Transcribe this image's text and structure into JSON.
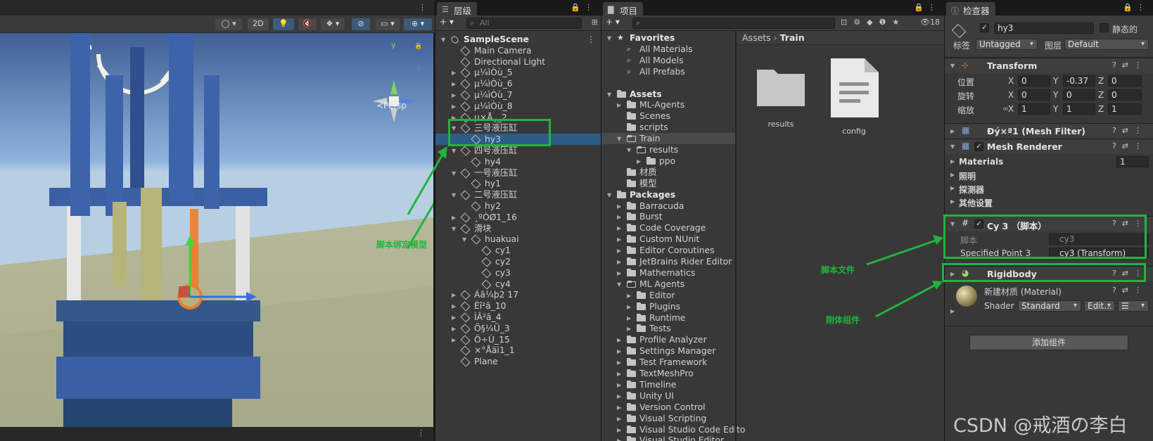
{
  "scene": {
    "toolbar": {
      "mode_2d": "2D"
    },
    "gizmo": {
      "persp_label": "≺Persp",
      "axis_y": "y",
      "axis_z": "z"
    },
    "annotation": "脚本绑定模型"
  },
  "hierarchy": {
    "tab": "层级",
    "search_placeholder": "All",
    "add": "+ ▾",
    "rows": [
      {
        "label": "SampleScene",
        "depth": 0,
        "arrow": "▼",
        "icon": "unity-icon",
        "bold": true
      },
      {
        "label": "Main Camera",
        "depth": 1,
        "arrow": "",
        "icon": "cube-icon"
      },
      {
        "label": "Directional Light",
        "depth": 1,
        "arrow": "",
        "icon": "cube-icon"
      },
      {
        "label": "µ¼ìÒù_5",
        "depth": 1,
        "arrow": "▶",
        "icon": "cube-icon"
      },
      {
        "label": "µ¼ìÒù_6",
        "depth": 1,
        "arrow": "▶",
        "icon": "cube-icon"
      },
      {
        "label": "µ¼ìÒù_7",
        "depth": 1,
        "arrow": "▶",
        "icon": "cube-icon"
      },
      {
        "label": "µ¼ìÒù_8",
        "depth": 1,
        "arrow": "▶",
        "icon": "cube-icon"
      },
      {
        "label": "µ×Å¸_2",
        "depth": 1,
        "arrow": "▶",
        "icon": "cube-icon"
      },
      {
        "label": "三号液压缸",
        "depth": 1,
        "arrow": "▼",
        "icon": "cube-icon"
      },
      {
        "label": "hy3",
        "depth": 2,
        "arrow": "",
        "icon": "cube-icon",
        "selected": true
      },
      {
        "label": "四号液压缸",
        "depth": 1,
        "arrow": "▼",
        "icon": "cube-icon"
      },
      {
        "label": "hy4",
        "depth": 2,
        "arrow": "",
        "icon": "cube-icon"
      },
      {
        "label": "一号液压缸",
        "depth": 1,
        "arrow": "▼",
        "icon": "cube-icon"
      },
      {
        "label": "hy1",
        "depth": 2,
        "arrow": "",
        "icon": "cube-icon"
      },
      {
        "label": "二号液压缸",
        "depth": 1,
        "arrow": "▼",
        "icon": "cube-icon"
      },
      {
        "label": "hy2",
        "depth": 2,
        "arrow": "",
        "icon": "cube-icon"
      },
      {
        "label": "¸ºÒØ1_16",
        "depth": 1,
        "arrow": "▶",
        "icon": "cube-icon"
      },
      {
        "label": "滑块",
        "depth": 1,
        "arrow": "▼",
        "icon": "cube-icon"
      },
      {
        "label": "huakuai",
        "depth": 2,
        "arrow": "▼",
        "icon": "cube-icon"
      },
      {
        "label": "cy1",
        "depth": 3,
        "arrow": "",
        "icon": "cube-icon"
      },
      {
        "label": "cy2",
        "depth": 3,
        "arrow": "",
        "icon": "cube-icon"
      },
      {
        "label": "cy3",
        "depth": 3,
        "arrow": "",
        "icon": "cube-icon"
      },
      {
        "label": "cy4",
        "depth": 3,
        "arrow": "",
        "icon": "cube-icon"
      },
      {
        "label": "Áã¼þ2 17",
        "depth": 1,
        "arrow": "▶",
        "icon": "cube-icon"
      },
      {
        "label": "Éî²ã_10",
        "depth": 1,
        "arrow": "▶",
        "icon": "cube-icon"
      },
      {
        "label": "ÌÂ²ã_4",
        "depth": 1,
        "arrow": "▶",
        "icon": "cube-icon"
      },
      {
        "label": "Ö§¼Ü_3",
        "depth": 1,
        "arrow": "▶",
        "icon": "cube-icon"
      },
      {
        "label": "Ö÷Ù_15",
        "depth": 1,
        "arrow": "▶",
        "icon": "cube-icon"
      },
      {
        "label": "×°Åäì1_1",
        "depth": 1,
        "arrow": "",
        "icon": "cube-icon"
      },
      {
        "label": "Plane",
        "depth": 1,
        "arrow": "",
        "icon": "cube-icon"
      }
    ]
  },
  "project": {
    "tab": "项目",
    "add": "+ ▾",
    "hidden_count": "18",
    "breadcrumb": [
      "Assets",
      "Train"
    ],
    "tree": [
      {
        "label": "Favorites",
        "depth": 0,
        "arrow": "▼",
        "icon": "star-icon",
        "bold": true
      },
      {
        "label": "All Materials",
        "depth": 1,
        "arrow": "",
        "icon": "search-icon"
      },
      {
        "label": "All Models",
        "depth": 1,
        "arrow": "",
        "icon": "search-icon"
      },
      {
        "label": "All Prefabs",
        "depth": 1,
        "arrow": "",
        "icon": "search-icon"
      },
      {
        "label": "",
        "depth": 0,
        "arrow": "",
        "icon": "none"
      },
      {
        "label": "Assets",
        "depth": 0,
        "arrow": "▼",
        "icon": "folder-icon",
        "bold": true
      },
      {
        "label": "ML-Agents",
        "depth": 1,
        "arrow": "▶",
        "icon": "folder-icon"
      },
      {
        "label": "Scenes",
        "depth": 1,
        "arrow": "",
        "icon": "folder-icon"
      },
      {
        "label": "scripts",
        "depth": 1,
        "arrow": "",
        "icon": "folder-icon"
      },
      {
        "label": "Train",
        "depth": 1,
        "arrow": "▼",
        "icon": "folder-open-icon",
        "selected": true
      },
      {
        "label": "results",
        "depth": 2,
        "arrow": "▼",
        "icon": "folder-open-icon"
      },
      {
        "label": "ppo",
        "depth": 3,
        "arrow": "▶",
        "icon": "folder-icon"
      },
      {
        "label": "材质",
        "depth": 1,
        "arrow": "",
        "icon": "folder-icon"
      },
      {
        "label": "模型",
        "depth": 1,
        "arrow": "",
        "icon": "folder-icon"
      },
      {
        "label": "Packages",
        "depth": 0,
        "arrow": "▼",
        "icon": "folder-icon",
        "bold": true
      },
      {
        "label": "Barracuda",
        "depth": 1,
        "arrow": "▶",
        "icon": "folder-icon"
      },
      {
        "label": "Burst",
        "depth": 1,
        "arrow": "▶",
        "icon": "folder-icon"
      },
      {
        "label": "Code Coverage",
        "depth": 1,
        "arrow": "▶",
        "icon": "folder-icon"
      },
      {
        "label": "Custom NUnit",
        "depth": 1,
        "arrow": "▶",
        "icon": "folder-icon"
      },
      {
        "label": "Editor Coroutines",
        "depth": 1,
        "arrow": "▶",
        "icon": "folder-icon"
      },
      {
        "label": "JetBrains Rider Editor",
        "depth": 1,
        "arrow": "▶",
        "icon": "folder-icon"
      },
      {
        "label": "Mathematics",
        "depth": 1,
        "arrow": "▶",
        "icon": "folder-icon"
      },
      {
        "label": "ML Agents",
        "depth": 1,
        "arrow": "▼",
        "icon": "folder-open-icon"
      },
      {
        "label": "Editor",
        "depth": 2,
        "arrow": "▶",
        "icon": "folder-icon"
      },
      {
        "label": "Plugins",
        "depth": 2,
        "arrow": "▶",
        "icon": "folder-icon"
      },
      {
        "label": "Runtime",
        "depth": 2,
        "arrow": "▶",
        "icon": "folder-icon"
      },
      {
        "label": "Tests",
        "depth": 2,
        "arrow": "▶",
        "icon": "folder-icon"
      },
      {
        "label": "Profile Analyzer",
        "depth": 1,
        "arrow": "▶",
        "icon": "folder-icon"
      },
      {
        "label": "Settings Manager",
        "depth": 1,
        "arrow": "▶",
        "icon": "folder-icon"
      },
      {
        "label": "Test Framework",
        "depth": 1,
        "arrow": "▶",
        "icon": "folder-icon"
      },
      {
        "label": "TextMeshPro",
        "depth": 1,
        "arrow": "▶",
        "icon": "folder-icon"
      },
      {
        "label": "Timeline",
        "depth": 1,
        "arrow": "▶",
        "icon": "folder-icon"
      },
      {
        "label": "Unity UI",
        "depth": 1,
        "arrow": "▶",
        "icon": "folder-icon"
      },
      {
        "label": "Version Control",
        "depth": 1,
        "arrow": "▶",
        "icon": "folder-icon"
      },
      {
        "label": "Visual Scripting",
        "depth": 1,
        "arrow": "▶",
        "icon": "folder-icon"
      },
      {
        "label": "Visual Studio Code Edito",
        "depth": 1,
        "arrow": "▶",
        "icon": "folder-icon"
      },
      {
        "label": "Visual Studio Editor",
        "depth": 1,
        "arrow": "▶",
        "icon": "folder-icon"
      }
    ],
    "assets": [
      {
        "label": "results",
        "icon": "folder-large-icon"
      },
      {
        "label": "config",
        "icon": "document-icon"
      }
    ]
  },
  "inspector": {
    "tab": "检查器",
    "object_name": "hy3",
    "static_label": "静态的",
    "tag_label": "标签",
    "tag_value": "Untagged",
    "layer_label": "图层",
    "layer_value": "Default",
    "transform": {
      "title": "Transform",
      "position_label": "位置",
      "rotation_label": "旋转",
      "scale_label": "缩放",
      "position": {
        "x": "0",
        "y": "-0.37",
        "z": "0"
      },
      "rotation": {
        "x": "0",
        "y": "0",
        "z": "0"
      },
      "scale": {
        "x": "1",
        "y": "1",
        "z": "1"
      }
    },
    "mesh_filter_title": "Ðý×ª1 (Mesh Filter)",
    "mesh_renderer": {
      "title": "Mesh Renderer",
      "materials_label": "Materials",
      "materials_count": "1",
      "lighting": "照明",
      "probes": "探测器",
      "other": "其他设置"
    },
    "script": {
      "title": "Cy 3 （脚本）",
      "script_label": "脚本",
      "script_value": "cy3",
      "point_label": "Specified Point 3",
      "point_value": "cy3 (Transform)"
    },
    "rigidbody_title": "Rigidbody",
    "material": {
      "name": "新建材质 (Material)",
      "shader_label": "Shader",
      "shader_value": "Standard",
      "edit_label": "Edit..."
    },
    "add_component": "添加组件",
    "annotations": {
      "script_file": "脚本文件",
      "rigidbody": "刚体组件"
    }
  },
  "watermark": "CSDN @戒酒の李白",
  "colors": {
    "annotation": "#22b33e",
    "selection": "#2c5d87",
    "panel": "#383838"
  }
}
